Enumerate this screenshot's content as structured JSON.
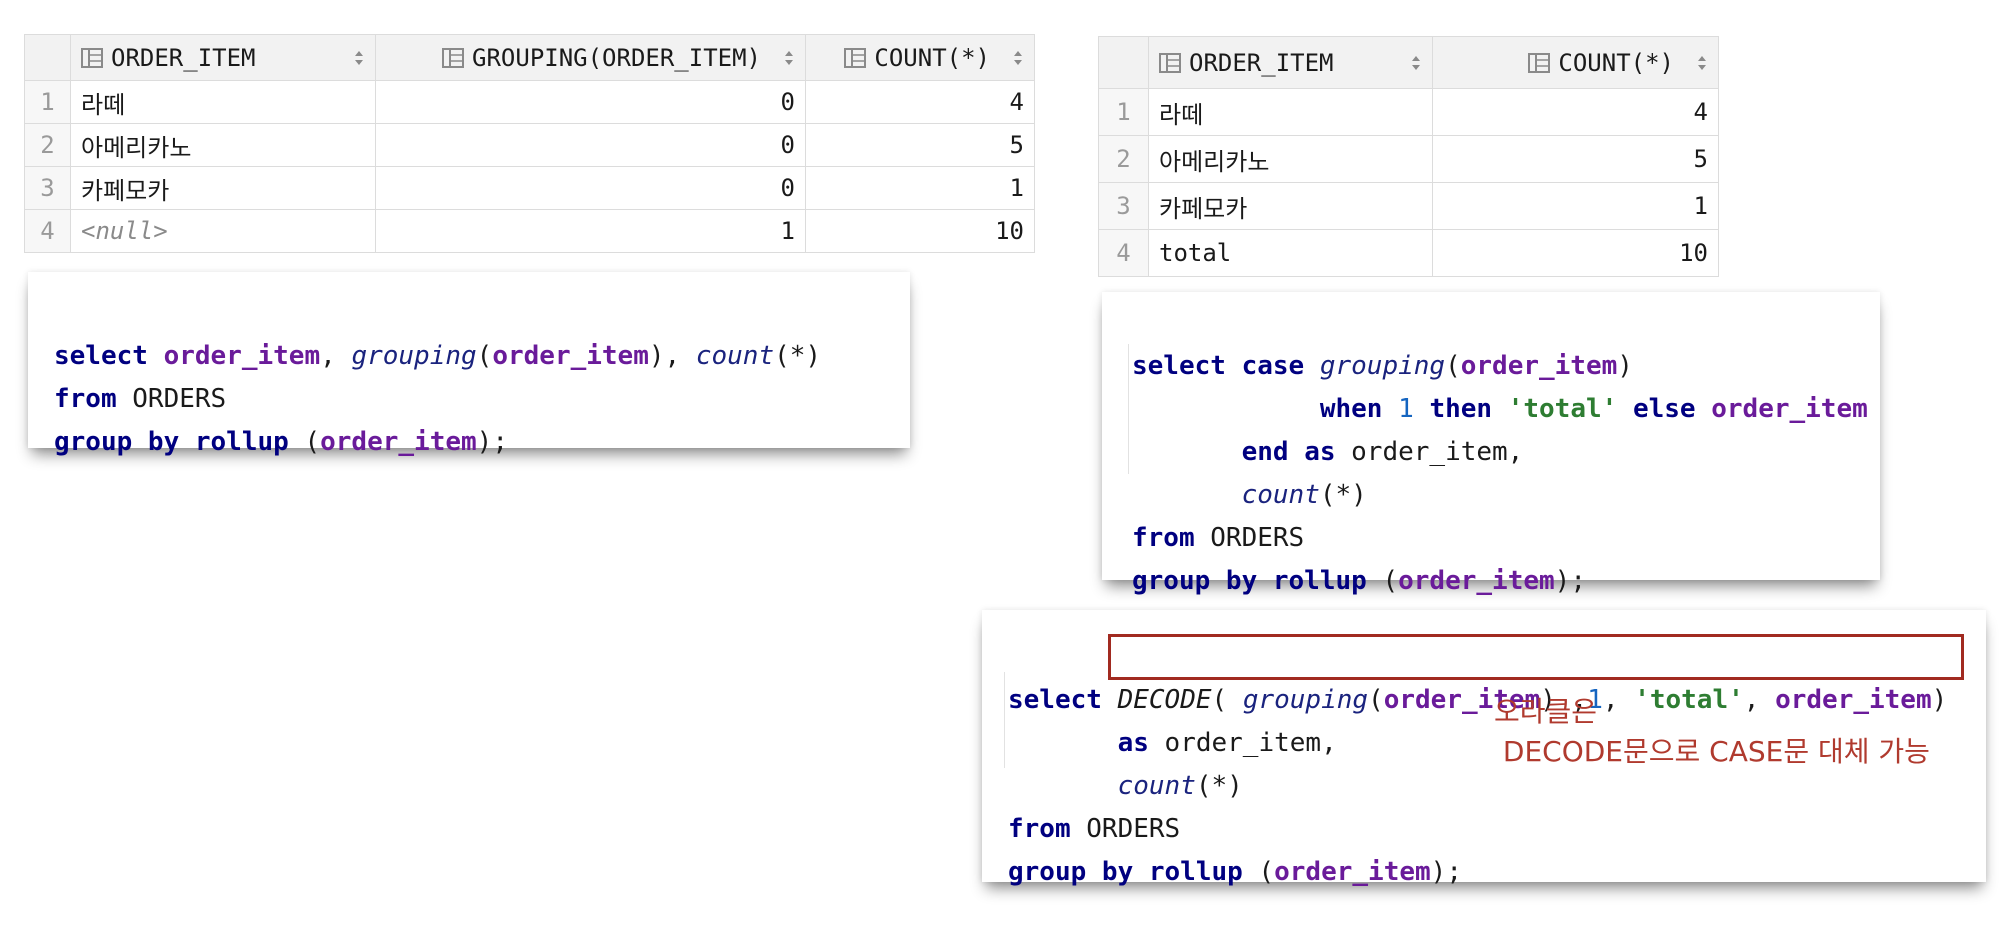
{
  "table_left": {
    "columns": [
      "ORDER_ITEM",
      "GROUPING(ORDER_ITEM)",
      "COUNT(*)"
    ],
    "rows": [
      {
        "n": "1",
        "order_item": "라떼",
        "grouping": "0",
        "count": "4"
      },
      {
        "n": "2",
        "order_item": "아메리카노",
        "grouping": "0",
        "count": "5"
      },
      {
        "n": "3",
        "order_item": "카페모카",
        "grouping": "0",
        "count": "1"
      },
      {
        "n": "4",
        "order_item": "<null>",
        "grouping": "1",
        "count": "10"
      }
    ]
  },
  "table_right": {
    "columns": [
      "ORDER_ITEM",
      "COUNT(*)"
    ],
    "rows": [
      {
        "n": "1",
        "order_item": "라떼",
        "count": "4"
      },
      {
        "n": "2",
        "order_item": "아메리카노",
        "count": "5"
      },
      {
        "n": "3",
        "order_item": "카페모카",
        "count": "1"
      },
      {
        "n": "4",
        "order_item": "total",
        "count": "10"
      }
    ]
  },
  "code1": {
    "l1": {
      "select": "select",
      "col": "order_item",
      "comma1": ", ",
      "fn": "grouping",
      "open": "(",
      "arg": "order_item",
      "close": "), ",
      "count": "count",
      "star": "(*)"
    },
    "l2": {
      "from": "from",
      "table": " ORDERS"
    },
    "l3": {
      "group": "group by rollup",
      "open": " (",
      "col": "order_item",
      "close": ");"
    }
  },
  "code2": {
    "l1": {
      "select": "select case",
      "fn": "grouping",
      "open": "(",
      "arg": "order_item",
      "close": ")"
    },
    "l2": {
      "when": "when",
      "one": "1",
      "then": "then",
      "str": "'total'",
      "else": "else",
      "col": "order_item"
    },
    "l3": {
      "end": "end as",
      "alias": " order_item,"
    },
    "l4": {
      "count": "count",
      "star": "(*)"
    },
    "l5": {
      "from": "from",
      "table": " ORDERS"
    },
    "l6": {
      "group": "group by rollup",
      "open": " (",
      "col": "order_item",
      "close": ");"
    }
  },
  "code3": {
    "l1": {
      "select": "select",
      "decode": "DECODE",
      "open": "( ",
      "fn": "grouping",
      "gopen": "(",
      "arg": "order_item",
      "gclose": ") ,",
      "one": "1",
      "comma": ", ",
      "str": "'total'",
      "comma2": ", ",
      "col": "order_item",
      "close": ")"
    },
    "l2": {
      "as": "as",
      "alias": " order_item,"
    },
    "l3": {
      "count": "count",
      "star": "(*)"
    },
    "l4": {
      "from": "from",
      "table": " ORDERS"
    },
    "l5": {
      "group": "group by rollup",
      "open": " (",
      "col": "order_item",
      "close": ");"
    }
  },
  "note": {
    "line1": "오라클은",
    "line2": " DECODE문으로 CASE문 대체 가능"
  },
  "colors": {
    "keyword": "#000080",
    "identifier": "#6a1b9a",
    "string": "#2e7d32",
    "annotation": "#b03a2e"
  },
  "icons": [
    "table-column-icon",
    "sort-arrows-icon"
  ]
}
